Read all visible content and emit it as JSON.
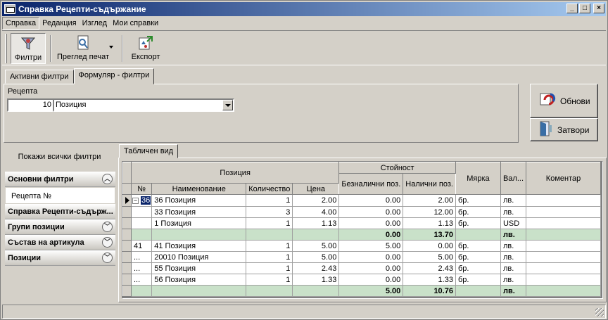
{
  "window": {
    "title": "Справка Рецепти-съдържание"
  },
  "menu": [
    "Справка",
    "Редакция",
    "Изглед",
    "Мои справки"
  ],
  "toolbar": {
    "filters": "Филтри",
    "print_preview": "Преглед печат",
    "export": "Експорт"
  },
  "top_tabs": [
    "Активни филтри",
    "Формуляр - филтри"
  ],
  "form": {
    "recipe_label": "Рецепта",
    "recipe_number": "10",
    "recipe_name": "Позиция"
  },
  "buttons": {
    "refresh": "Обнови",
    "close": "Затвори"
  },
  "left_panel": {
    "show_all": "Покажи всички филтри",
    "groups": [
      {
        "label": "Основни филтри",
        "expanded": true,
        "items": [
          "Рецепта №"
        ]
      },
      {
        "label": "Справка Рецепти-съдърж..."
      },
      {
        "label": "Групи позиции"
      },
      {
        "label": "Състав на артикула"
      },
      {
        "label": "Позиции"
      }
    ]
  },
  "grid": {
    "tab": "Табличен вид",
    "headers": {
      "position": "Позиция",
      "value": "Стойност",
      "number": "№",
      "name": "Наименование",
      "quantity": "Количество",
      "price": "Цена",
      "cashless": "Безналични поз.",
      "cash": "Налични поз.",
      "unit": "Мярка",
      "currency": "Вал...",
      "comment": "Коментар"
    },
    "rows": [
      {
        "no": "36",
        "name": "36 Позиция",
        "qty": "1",
        "price": "2.00",
        "cashless": "0.00",
        "cash": "2.00",
        "unit": "бр.",
        "cur": "лв.",
        "comment": ""
      },
      {
        "no": "",
        "name": "33 Позиция",
        "qty": "3",
        "price": "4.00",
        "cashless": "0.00",
        "cash": "12.00",
        "unit": "бр.",
        "cur": "лв.",
        "comment": ""
      },
      {
        "no": "",
        "name": "1 Позиция",
        "qty": "1",
        "price": "1.13",
        "cashless": "0.00",
        "cash": "1.13",
        "unit": "бр.",
        "cur": "USD",
        "comment": ""
      },
      {
        "sum": true,
        "cashless": "0.00",
        "cash": "13.70",
        "cur": "лв."
      },
      {
        "no": "41",
        "name": "41 Позиция",
        "qty": "1",
        "price": "5.00",
        "cashless": "5.00",
        "cash": "0.00",
        "unit": "бр.",
        "cur": "лв.",
        "comment": ""
      },
      {
        "no": "...",
        "name": "20010 Позиция",
        "qty": "1",
        "price": "5.00",
        "cashless": "0.00",
        "cash": "5.00",
        "unit": "бр.",
        "cur": "лв.",
        "comment": ""
      },
      {
        "no": "...",
        "name": "55 Позиция",
        "qty": "1",
        "price": "2.43",
        "cashless": "0.00",
        "cash": "2.43",
        "unit": "бр.",
        "cur": "лв.",
        "comment": ""
      },
      {
        "no": "...",
        "name": "56 Позиция",
        "qty": "1",
        "price": "1.33",
        "cashless": "0.00",
        "cash": "1.33",
        "unit": "бр.",
        "cur": "лв.",
        "comment": ""
      },
      {
        "sum": true,
        "cashless": "5.00",
        "cash": "10.76",
        "cur": "лв."
      }
    ]
  },
  "colors": {
    "title_start": "#0a246a",
    "title_end": "#a6caf0",
    "sum_row": "#c9e1c9",
    "face": "#d4d0c8"
  }
}
